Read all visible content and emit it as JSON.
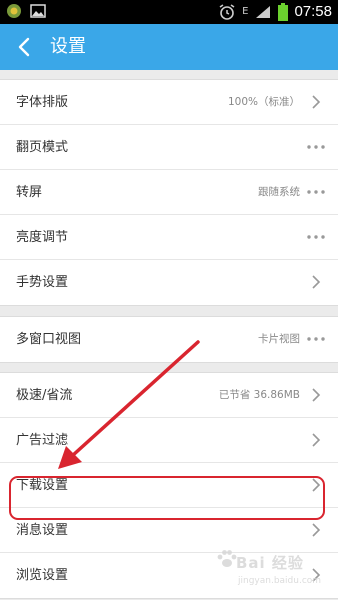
{
  "status_bar": {
    "time": "07:58",
    "network": "E",
    "icons": [
      "app-notification-icon",
      "image-icon",
      "alarm-icon",
      "signal-icon",
      "battery-icon"
    ]
  },
  "app_bar": {
    "title": "设置",
    "back_icon": "chevron-left-icon"
  },
  "groups": [
    {
      "rows": [
        {
          "label": "字体排版",
          "value": "100%（标准）",
          "icon": "chevron-right"
        },
        {
          "label": "翻页模式",
          "value": "",
          "icon": "more-dots"
        },
        {
          "label": "转屏",
          "value": "跟随系统",
          "icon": "more-dots"
        },
        {
          "label": "亮度调节",
          "value": "",
          "icon": "more-dots"
        },
        {
          "label": "手势设置",
          "value": "",
          "icon": "chevron-right"
        }
      ]
    },
    {
      "rows": [
        {
          "label": "多窗口视图",
          "value": "卡片视图",
          "icon": "more-dots"
        }
      ]
    },
    {
      "rows": [
        {
          "label": "极速/省流",
          "value": "已节省 36.86MB",
          "icon": "chevron-right"
        },
        {
          "label": "广告过滤",
          "value": "",
          "icon": "chevron-right"
        },
        {
          "label": "下载设置",
          "value": "",
          "icon": "chevron-right"
        },
        {
          "label": "消息设置",
          "value": "",
          "icon": "chevron-right"
        },
        {
          "label": "浏览设置",
          "value": "",
          "icon": "chevron-right"
        }
      ]
    }
  ],
  "annotation": {
    "highlight_color": "#d9252f",
    "arrow_color": "#d9252f",
    "highlighted_row": "下载设置"
  },
  "watermark": {
    "text_main": "Bai 经验",
    "text_sub": "jingyan.baidu.com"
  },
  "colors": {
    "app_bar": "#3aa7e8",
    "background": "#ebebeb",
    "row_background": "#ffffff"
  }
}
